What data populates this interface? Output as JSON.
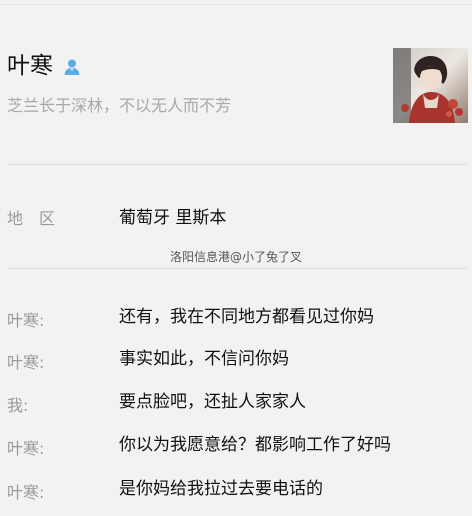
{
  "profile": {
    "name": "叶寒",
    "signature": "芝兰长于深林，不以无人而不芳",
    "icons": {
      "verified": "user-icon",
      "avatar": "avatar-photo"
    }
  },
  "region": {
    "label": "地区",
    "value": "葡萄牙 里斯本"
  },
  "watermark": "洛阳信息港@小了兔了叉",
  "chat": [
    {
      "speaker": "叶寒:",
      "text": "还有，我在不同地方都看见过你妈"
    },
    {
      "speaker": "叶寒:",
      "text": "事实如此，不信问你妈"
    },
    {
      "speaker": "我:",
      "text": "要点脸吧，还扯人家家人"
    },
    {
      "speaker": "叶寒:",
      "text": "你以为我愿意给？都影响工作了好吗"
    },
    {
      "speaker": "叶寒:",
      "text": "是你妈给我拉过去要电话的"
    }
  ],
  "colors": {
    "background": "#f2f2f2",
    "icon_blue": "#5aaee6",
    "muted_text": "#9a9a9a"
  }
}
